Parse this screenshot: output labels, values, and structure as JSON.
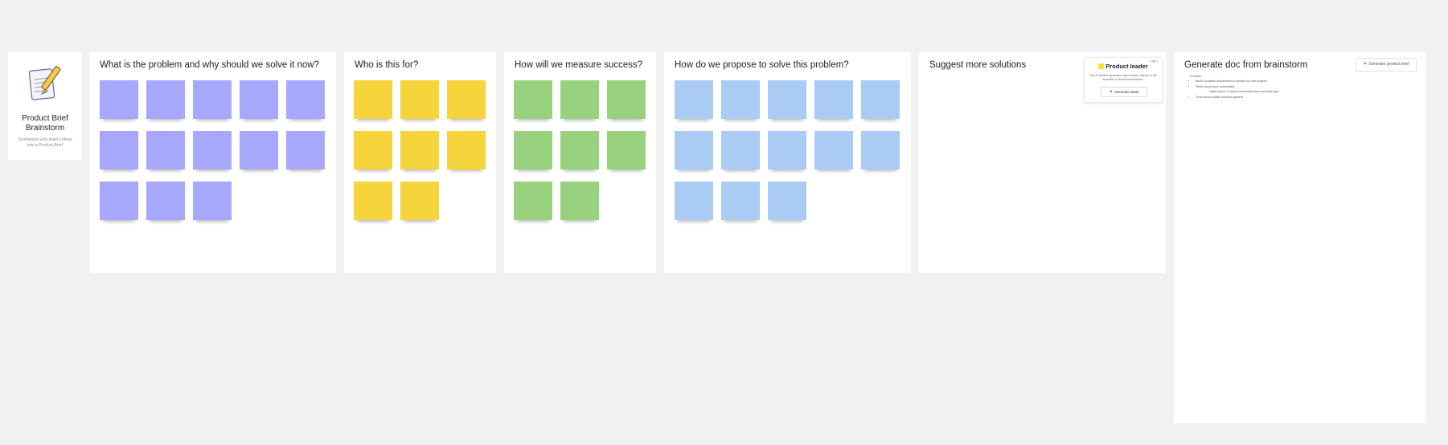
{
  "intro": {
    "title": "Product Brief Brainstorm",
    "description": "Synthesize your team's ideas into a Product Brief"
  },
  "frames": [
    {
      "id": "problem",
      "title": "What is the problem and why should we solve it now?",
      "color": "purple",
      "count": 13,
      "columns": 5
    },
    {
      "id": "audience",
      "title": "Who is this for?",
      "color": "yellow",
      "count": 8,
      "columns": 3
    },
    {
      "id": "success",
      "title": "How will we measure success?",
      "color": "green",
      "count": 8,
      "columns": 3
    },
    {
      "id": "solution",
      "title": "How do we propose to solve this problem?",
      "color": "blue",
      "count": 13,
      "columns": 5
    },
    {
      "id": "suggest",
      "title": "Suggest more solutions",
      "color": "",
      "count": 0,
      "columns": 0
    },
    {
      "id": "gendoc",
      "title": "Generate doc from brainstorm",
      "color": "",
      "count": 0,
      "columns": 0
    }
  ],
  "colors": {
    "purple": "#a7a8fb",
    "yellow": "#f5d43c",
    "green": "#99d27e",
    "blue": "#aacbf4"
  },
  "product_leader": {
    "title": "Product leader",
    "badge": "AI",
    "description": "This AI sidekick generates expert advice, trained on the expertise of Miro/Product leaders.",
    "button_label": "Generate ideas"
  },
  "generate_doc": {
    "button_label": "Generate product brief",
    "intro": "Includes:",
    "items": [
      "Build a scalable architecture to prepare for next projects",
      "Think about cloud connectivity",
      "Think about mobile software systems"
    ],
    "sub_item": "initial version of cloud connectivity layer and data layer"
  }
}
